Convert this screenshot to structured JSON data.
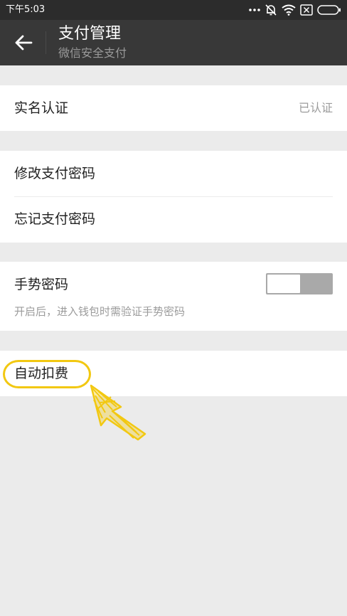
{
  "status_bar": {
    "time": "下午5:03",
    "icons": [
      "more-dots-icon",
      "alarm-off-icon",
      "wifi-icon",
      "sim-off-icon",
      "battery-icon"
    ]
  },
  "header": {
    "title": "支付管理",
    "subtitle": "微信安全支付",
    "back_icon": "back-arrow-icon"
  },
  "sections": {
    "real_name": {
      "label": "实名认证",
      "value": "已认证"
    },
    "password": {
      "change_label": "修改支付密码",
      "forgot_label": "忘记支付密码"
    },
    "gesture": {
      "label": "手势密码",
      "description": "开启后，进入钱包时需验证手势密码",
      "enabled": false
    },
    "auto_deduct": {
      "label": "自动扣费"
    }
  },
  "colors": {
    "status_bar": "#2c2c2c",
    "header": "#383838",
    "background": "#ebebeb",
    "annotation": "#f2c811"
  }
}
